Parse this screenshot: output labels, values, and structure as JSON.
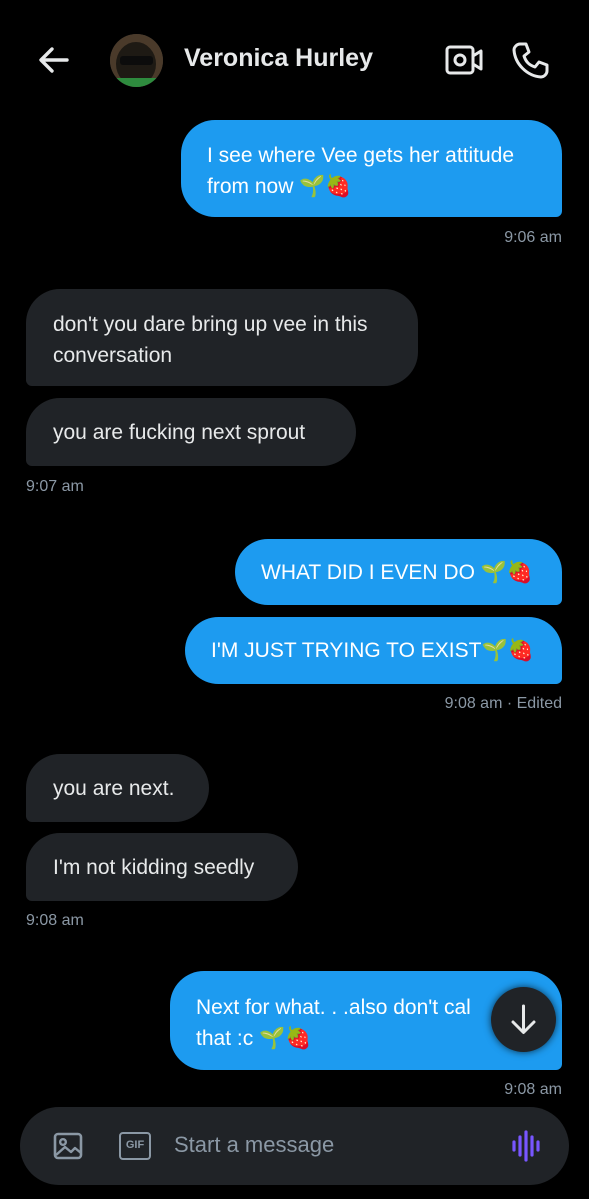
{
  "header": {
    "back_icon": "arrow-left-icon",
    "contact_name": "Veronica Hurley",
    "video_icon": "video-call-icon",
    "phone_icon": "phone-call-icon"
  },
  "messages": [
    {
      "direction": "out",
      "lines": [
        "I see where Vee gets her attitude",
        "from now"
      ],
      "emoji": "🌱🍓"
    },
    {
      "direction": "meta-out",
      "text": "9:06 am"
    },
    {
      "direction": "in",
      "lines": [
        "don't you dare bring up vee in this",
        "conversation"
      ]
    },
    {
      "direction": "in",
      "lines": [
        "you are fucking next sprout"
      ]
    },
    {
      "direction": "meta-in",
      "text": "9:07 am"
    },
    {
      "direction": "out",
      "lines": [
        "WHAT DID I EVEN DO"
      ],
      "emoji": "🌱🍓"
    },
    {
      "direction": "out",
      "lines": [
        "I'M JUST TRYING TO EXIST"
      ],
      "emoji": "🌱🍓"
    },
    {
      "direction": "meta-out",
      "text": "9:08 am · Edited"
    },
    {
      "direction": "in",
      "lines": [
        "you are next."
      ]
    },
    {
      "direction": "in",
      "lines": [
        "I'm not kidding seedly"
      ]
    },
    {
      "direction": "meta-in",
      "text": "9:08 am"
    },
    {
      "direction": "out",
      "lines": [
        "Next for what. . .also don't cal",
        "that :c"
      ],
      "emoji": "🌱🍓"
    },
    {
      "direction": "meta-out",
      "text": "9:08 am"
    }
  ],
  "scroll_button": {
    "icon": "arrow-down-icon"
  },
  "composer": {
    "image_icon": "image-icon",
    "gif_icon": "gif-icon",
    "gif_label": "GIF",
    "placeholder": "Start a message",
    "voice_icon": "voice-message-icon"
  },
  "colors": {
    "background": "#000000",
    "outgoing_bubble": "#1d9bf0",
    "incoming_bubble": "#202327",
    "meta_text": "#8b98a5",
    "voice_accent": "#7856ff"
  }
}
